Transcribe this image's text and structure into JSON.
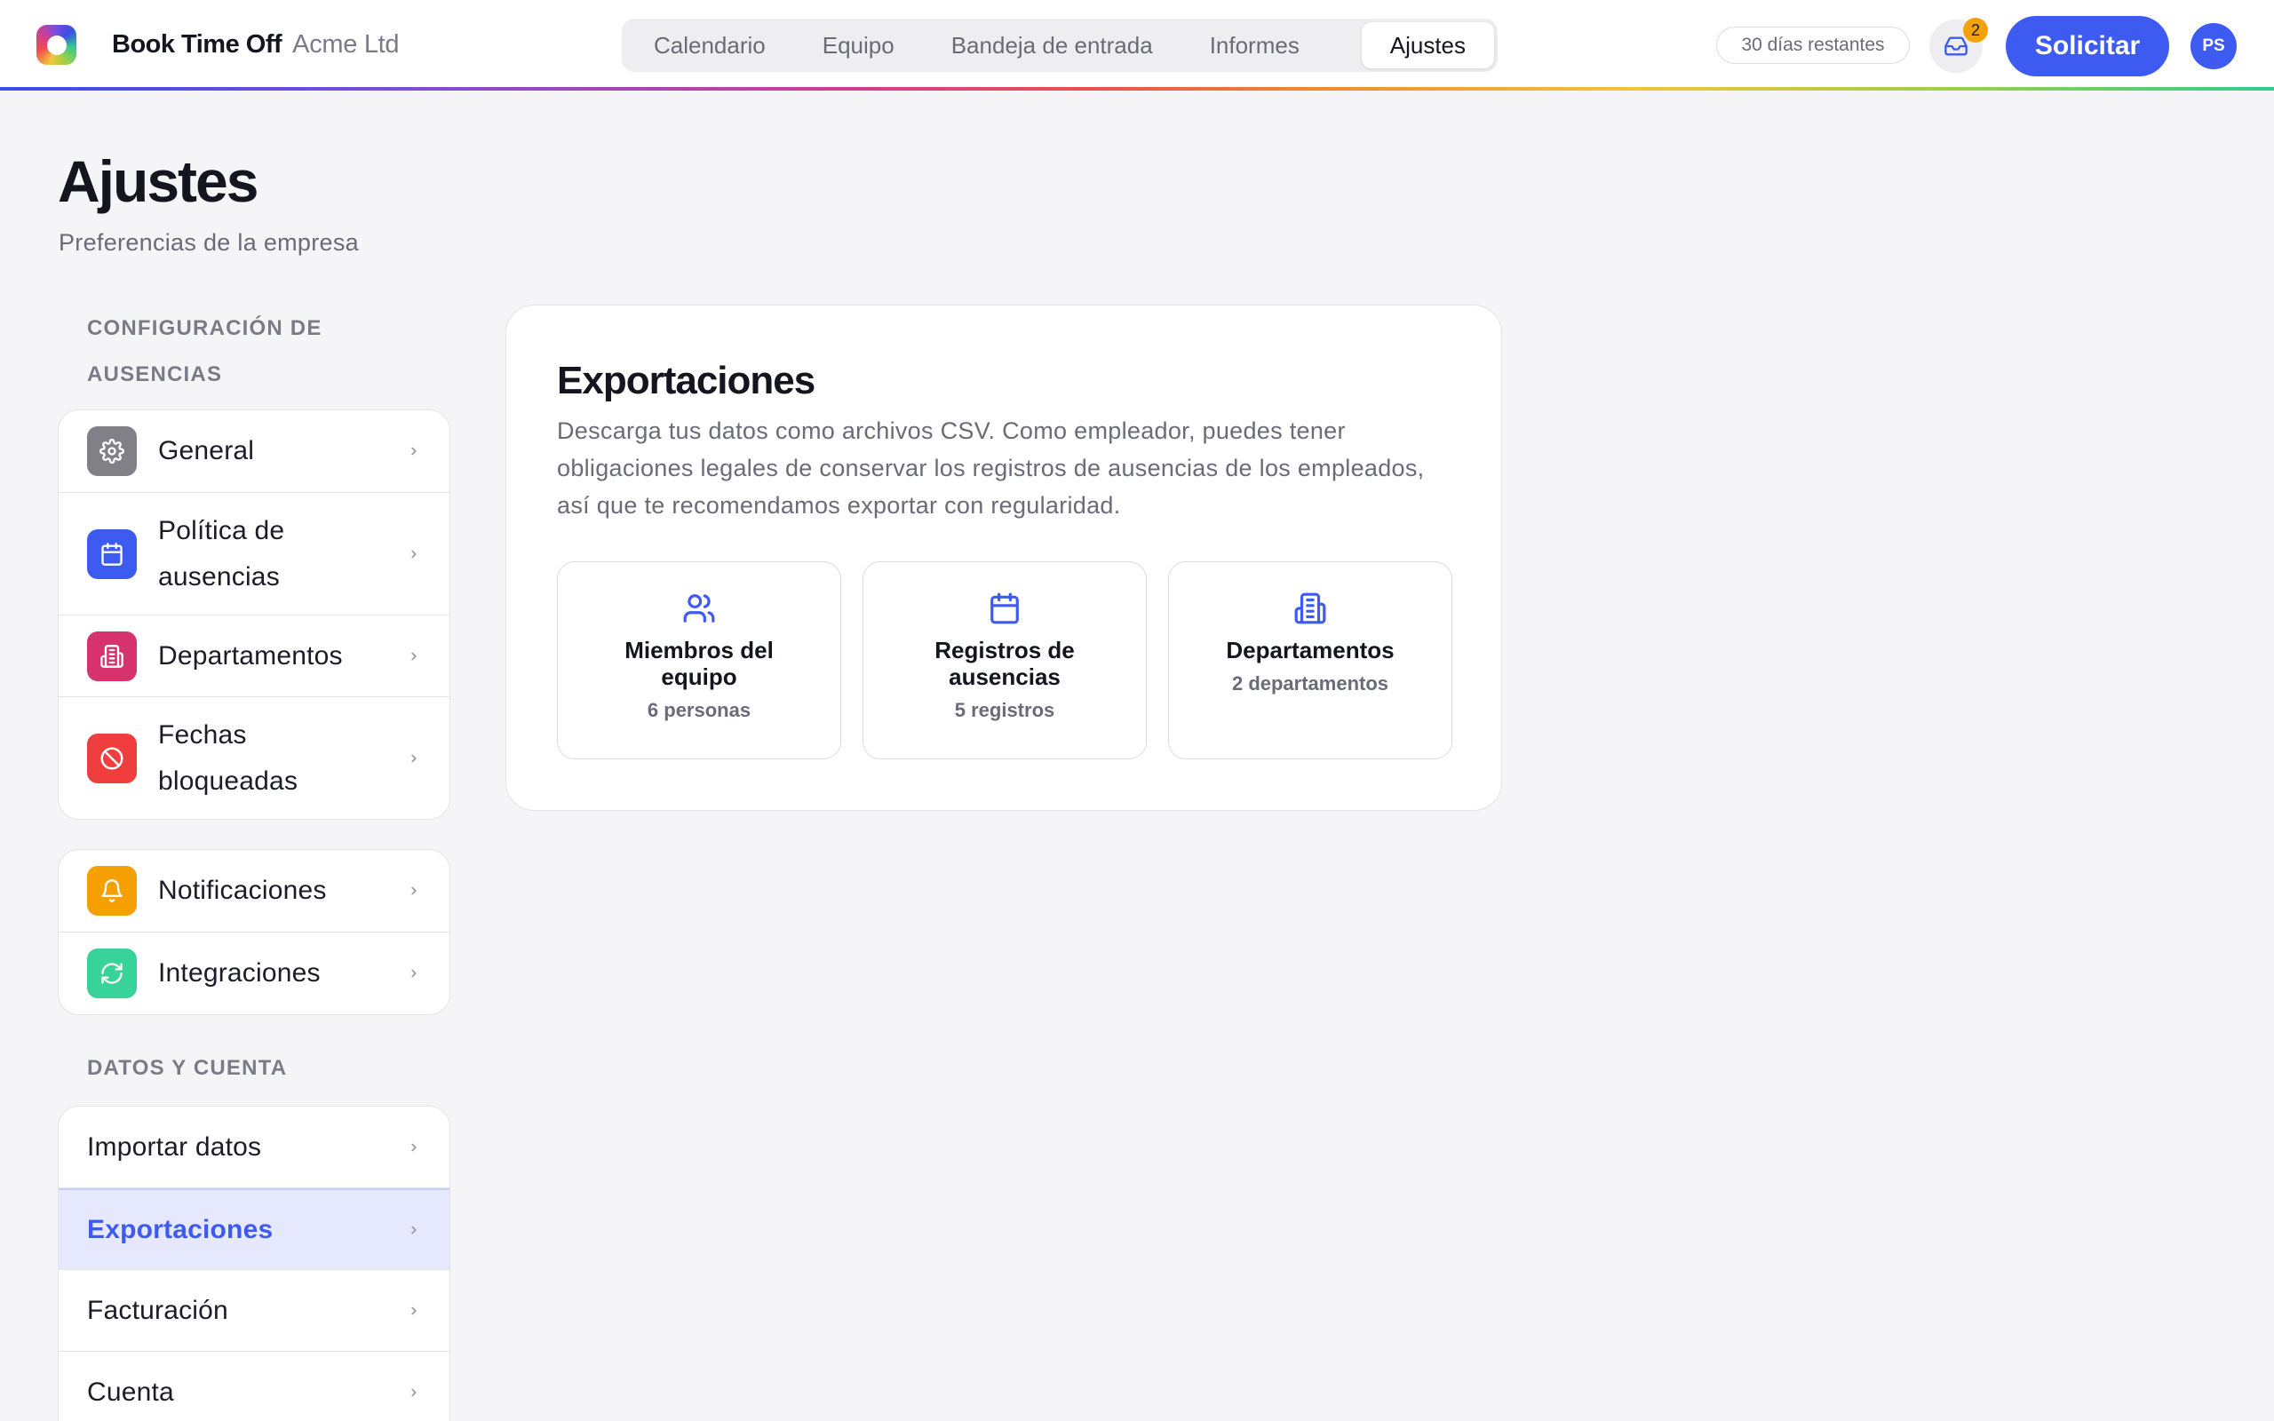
{
  "app": {
    "name": "Book Time Off",
    "company": "Acme Ltd"
  },
  "nav": {
    "tabs": [
      {
        "label": "Calendario"
      },
      {
        "label": "Equipo"
      },
      {
        "label": "Bandeja de entrada"
      },
      {
        "label": "Informes"
      },
      {
        "label": "Ajustes"
      }
    ],
    "active_tab": "Ajustes"
  },
  "header": {
    "days_remaining": "30 días restantes",
    "inbox_count": "2",
    "request_label": "Solicitar",
    "avatar_initials": "PS"
  },
  "page": {
    "title": "Ajustes",
    "subtitle": "Preferencias de la empresa"
  },
  "sidebar": {
    "section_1_label": "CONFIGURACIÓN DE AUSENCIAS",
    "group_1": [
      {
        "label": "General",
        "icon": "gear-icon",
        "color": "#808086"
      },
      {
        "label": "Política de ausencias",
        "icon": "calendar-icon",
        "color": "#3d5af1"
      },
      {
        "label": "Departamentos",
        "icon": "building-icon",
        "color": "#d6336c"
      },
      {
        "label": "Fechas bloqueadas",
        "icon": "block-icon",
        "color": "#f03e3e"
      }
    ],
    "group_2": [
      {
        "label": "Notificaciones",
        "icon": "bell-icon",
        "color": "#f59f00"
      },
      {
        "label": "Integraciones",
        "icon": "refresh-icon",
        "color": "#37d39a"
      }
    ],
    "section_2_label": "DATOS Y CUENTA",
    "group_3": [
      {
        "label": "Importar datos"
      },
      {
        "label": "Exportaciones",
        "selected": true
      },
      {
        "label": "Facturación"
      },
      {
        "label": "Cuenta"
      }
    ]
  },
  "exports": {
    "title": "Exportaciones",
    "description": "Descarga tus datos como archivos CSV. Como empleador, puedes tener obligaciones legales de conservar los registros de ausencias de los empleados, así que te recomendamos exportar con regularidad.",
    "tiles": [
      {
        "title": "Miembros del equipo",
        "subtitle": "6 personas",
        "icon": "users-icon"
      },
      {
        "title": "Registros de ausencias",
        "subtitle": "5 registros",
        "icon": "calendar-icon"
      },
      {
        "title": "Departamentos",
        "subtitle": "2 departamentos",
        "icon": "building-icon"
      }
    ]
  },
  "colors": {
    "accent": "#3d5af1",
    "selected_bg": "#e6e9fd",
    "badge": "#f5a10a"
  }
}
